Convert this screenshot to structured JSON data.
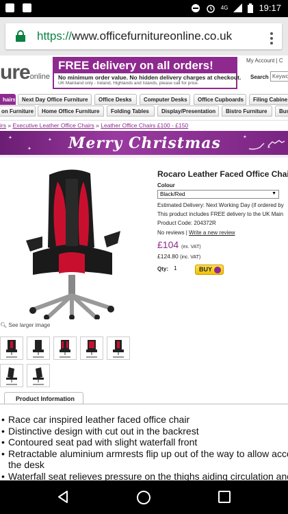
{
  "status": {
    "time": "19:17",
    "network": "4G"
  },
  "browser": {
    "url_scheme": "https://",
    "url_rest": "www.officefurnitureonline.co.uk"
  },
  "site": {
    "logo_main": "ure",
    "logo_sub": "online",
    "promo_title": "FREE delivery on all orders!",
    "promo_line1": "No minimum order value. No hidden delivery charges at checkout.",
    "promo_line2": "UK Mainland only - Ireland, Highlands and Islands, please call for price.",
    "my_account": "My Account  |  C",
    "search_label": "Search",
    "search_placeholder": "Keywo"
  },
  "nav_row1": [
    "hairs",
    "Next Day Office Furniture",
    "Office Desks",
    "Computer Desks",
    "Office Cupboards",
    "Filing Cabine"
  ],
  "nav_row2": [
    "on Furniture",
    "Home Office Furniture",
    "Folding Tables",
    "Display/Presentation",
    "Bistro Furniture",
    "Bus"
  ],
  "breadcrumb": {
    "b0": "irs",
    "sep": " » ",
    "b1": "Executive Leather Office Chairs",
    "b2": "Leather Office Chairs £100 - £150"
  },
  "banner": {
    "text": "Merry Christmas"
  },
  "product": {
    "title": "Rocaro Leather Faced Office Chair",
    "colour_label": "Colour",
    "colour_value": "Black/Red",
    "delivery": "Estimated Delivery: Next Working Day (if ordered by",
    "free_delivery": "This product includes FREE delivery to the UK Main",
    "code": "Product Code: 204372R",
    "reviews": "No reviews  |",
    "write_review": "Write a new review",
    "price": "£104",
    "price_note": "(ex. VAT)",
    "price_inc": "£124.80",
    "price_inc_note": "(inc. VAT)",
    "qty_label": "Qty:",
    "qty_value": "1",
    "buy_label": "BUY",
    "see_larger": "See larger image"
  },
  "info_tab": "Product Information",
  "bullets": {
    "b1": "Race car inspired leather faced office chair",
    "b2": "Distinctive design with cut out in the backrest",
    "b3": "Contoured seat pad with slight waterfall front",
    "b4": "Retractable aluminium armrests flip up out of the way to allow acco",
    "b4cont": "the desk",
    "b5": "Waterfall seat relieves pressure on the thighs aiding circulation and"
  },
  "colors": {
    "brand_purple": "#8e2a8f",
    "buy_yellow": "#f1c000"
  },
  "icons": [
    "close-icon",
    "alarm-icon",
    "signal-icon",
    "battery-icon",
    "lock-icon",
    "more-icon",
    "zoom-icon",
    "back-icon",
    "home-icon",
    "recents-icon"
  ]
}
